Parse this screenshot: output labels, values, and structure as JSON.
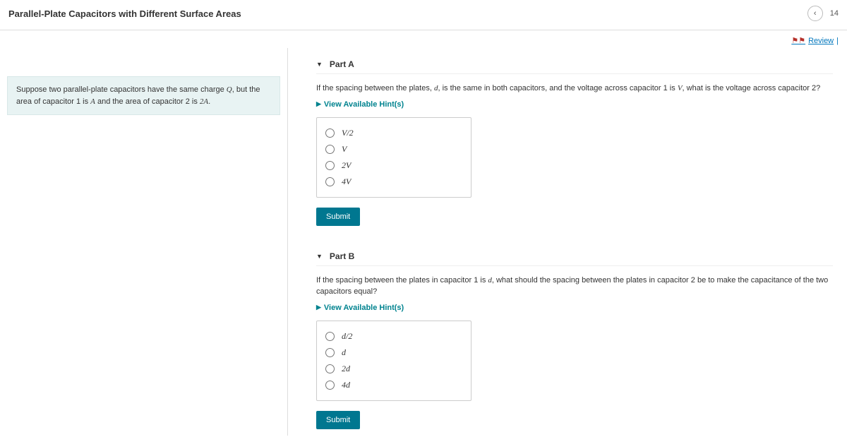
{
  "header": {
    "title": "Parallel-Plate Capacitors with Different Surface Areas",
    "page_fragment": "14"
  },
  "review": {
    "label": "Review"
  },
  "intro": {
    "prefix": "Suppose two parallel-plate capacitors have the same charge ",
    "var1": "Q",
    "mid1": ", but the area of capacitor 1 is ",
    "var2": "A",
    "mid2": " and the area of capacitor 2 is ",
    "var3": "2A",
    "suffix": "."
  },
  "parts": {
    "a": {
      "label": "Part A",
      "q_prefix": "If the spacing between the plates, ",
      "q_var1": "d",
      "q_mid1": ", is the same in both capacitors, and the voltage across capacitor 1 is ",
      "q_var2": "V",
      "q_suffix": ", what is the voltage across capacitor 2?",
      "hints": "View Available Hint(s)",
      "options": [
        "V/2",
        "V",
        "2V",
        "4V"
      ],
      "submit": "Submit"
    },
    "b": {
      "label": "Part B",
      "q_prefix": "If the spacing between the plates in capacitor 1 is ",
      "q_var1": "d",
      "q_suffix": ", what should the spacing between the plates in capacitor 2 be to make the capacitance of the two capacitors equal?",
      "hints": "View Available Hint(s)",
      "options": [
        "d/2",
        "d",
        "2d",
        "4d"
      ],
      "submit": "Submit"
    }
  }
}
